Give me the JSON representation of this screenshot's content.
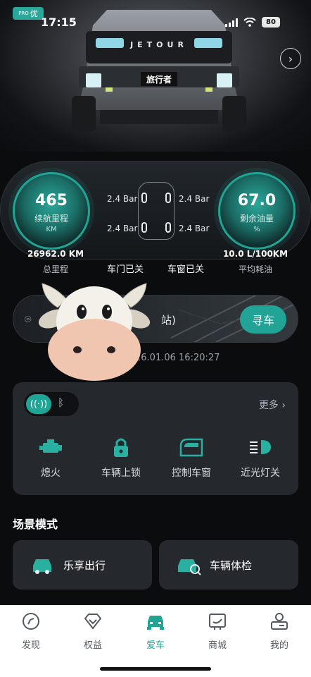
{
  "status_bar": {
    "app_badge": "优",
    "app_badge_sub": "PRO",
    "time": "17:15",
    "battery": "80"
  },
  "hero": {
    "brand_letters": "JETOUR",
    "plate_text": "旅行者"
  },
  "dashboard": {
    "left_gauge": {
      "value": "465",
      "label": "续航里程",
      "unit": "KM"
    },
    "left_sub": {
      "value": "26962.0 KM",
      "label": "总里程"
    },
    "right_gauge": {
      "value": "67.0",
      "label": "剩余油量",
      "unit": "%"
    },
    "right_sub": {
      "value": "10.0 L/100KM",
      "label": "平均耗油"
    },
    "tires": {
      "front_left": "2.4 Bar",
      "front_right": "2.4 Bar",
      "rear_left": "2.4 Bar",
      "rear_right": "2.4 Bar",
      "fl_code": "0",
      "fr_code": "0",
      "rl_code": "0",
      "rr_code": "0"
    },
    "door_status": "车门已关",
    "window_status": "车窗已关"
  },
  "find_car": {
    "location_suffix": "站)",
    "button": "寻车",
    "timestamp": "26.01.06 16:20:27"
  },
  "controls": {
    "more": "更多",
    "items": [
      {
        "label": "熄火",
        "icon": "engine-icon"
      },
      {
        "label": "车辆上锁",
        "icon": "lock-icon"
      },
      {
        "label": "控制车窗",
        "icon": "window-icon"
      },
      {
        "label": "近光灯关",
        "icon": "headlight-icon"
      }
    ]
  },
  "scenes": {
    "title": "场景模式",
    "items": [
      {
        "label": "乐享出行",
        "icon": "car-icon"
      },
      {
        "label": "车辆体检",
        "icon": "car-check-icon"
      }
    ]
  },
  "tabbar": {
    "active": "爱车",
    "accent": "#1fa596",
    "items": [
      {
        "label": "发现",
        "icon": "compass-icon"
      },
      {
        "label": "权益",
        "icon": "diamond-icon"
      },
      {
        "label": "爱车",
        "icon": "car-icon"
      },
      {
        "label": "商城",
        "icon": "shop-icon"
      },
      {
        "label": "我的",
        "icon": "profile-icon"
      }
    ]
  }
}
